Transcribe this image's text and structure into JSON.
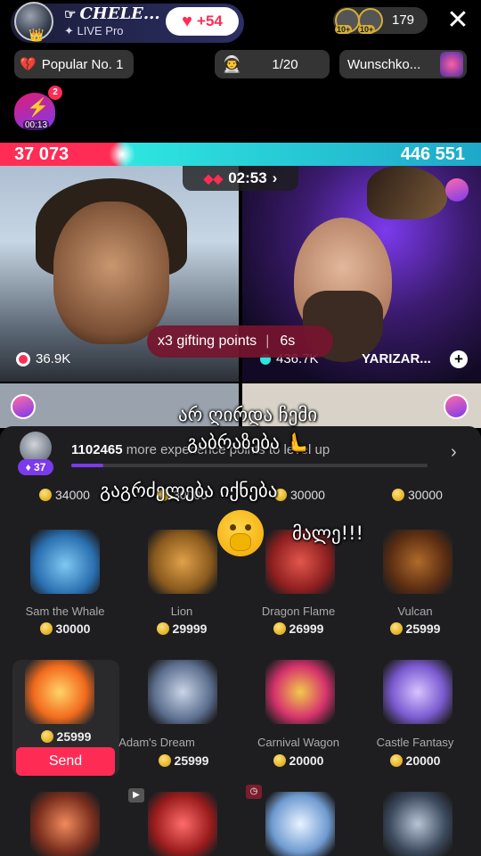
{
  "header": {
    "host_name": "CHELE...",
    "host_prefix_icon": "pointing-hand-icon",
    "host_subtitle": "LIVE Pro",
    "likes": "+54",
    "viewer_badges": [
      "10+",
      "10+"
    ],
    "viewer_count": "179"
  },
  "chips": {
    "popular": "Popular No. 1",
    "rank": "1/20",
    "wishlist": "Wunschko..."
  },
  "treasure": {
    "badge": "2",
    "timer": "00:13"
  },
  "battle": {
    "left_score": "37 073",
    "right_score": "446 551",
    "timer": "02:53",
    "left_points": "36.9K",
    "right_points": "436.7K",
    "right_name": "YARIZAR...",
    "multiplier_text": "x3 gifting points",
    "multiplier_time": "6s",
    "colors": {
      "left": "#ff2d55",
      "right": "#2ee6e0"
    }
  },
  "level": {
    "badge": "37",
    "points": "1102465",
    "text": " more experience points to level up",
    "progress": 0.09
  },
  "top_prices": [
    "34000",
    "30000",
    "30000",
    "30000"
  ],
  "gifts": [
    {
      "name": "Sam the Whale",
      "price": "30000"
    },
    {
      "name": "Lion",
      "price": "29999"
    },
    {
      "name": "Dragon Flame",
      "price": "26999"
    },
    {
      "name": "Vulcan",
      "price": "25999"
    },
    {
      "name": "",
      "price": "25999"
    },
    {
      "name": "Adam's Dream",
      "price": "25999"
    },
    {
      "name": "Carnival Wagon",
      "price": "20000"
    },
    {
      "name": "Castle Fantasy",
      "price": "20000"
    }
  ],
  "send_label": "Send",
  "caption": {
    "line1": "არ ღირდა ჩემი",
    "line2": "გაბრაზება",
    "line3": "გაგრძელება იქნება",
    "line4": "მალე!!!"
  }
}
